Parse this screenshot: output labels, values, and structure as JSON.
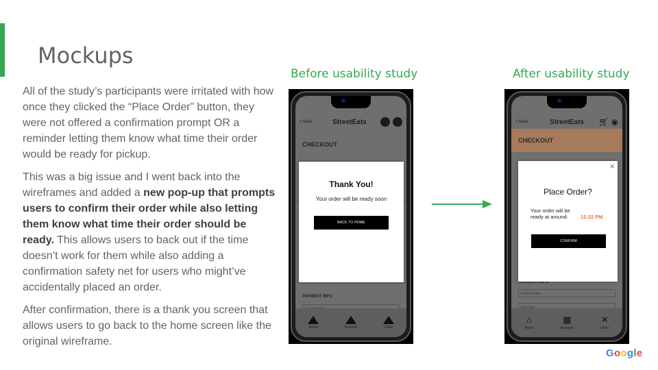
{
  "slide": {
    "title": "Mockups",
    "paragraphs": {
      "p1": "All of the study’s participants were irritated with how once they clicked the “Place Order” button, they were not offered a confirmation prompt OR a reminder letting them know what time their order would be ready for pickup.",
      "p2_before": "This was a big issue and I went back into the wireframes and added a ",
      "p2_bold": "new pop-up that prompts users to confirm their order while also letting them know what time their order should be ready.",
      "p2_after": " This allows users to back out if the time doesn’t work for them while also adding a confirmation safety net for users who might’ve accidentally placed an order.",
      "p3": "After confirmation, there is a thank you screen that allows users to go back to the home screen like the original wireframe."
    },
    "captions": {
      "before": "Before usability study",
      "after": "After usability study"
    },
    "logo_text": "Google",
    "colors": {
      "accent": "#34a853",
      "time": "#e8772e",
      "checkout_band": "#a67a5b"
    }
  },
  "before_mockup": {
    "back_label": "< Back",
    "brand": "StreetEats",
    "section_title": "CHECKOUT",
    "modal": {
      "title": "Thank You!",
      "subtitle": "Your order will be ready soon",
      "button": "BACK TO HOME"
    },
    "payment_label": "PAYMENT INFO",
    "card_field": "Card Number",
    "nav": [
      "Home",
      "Rewards",
      "Order"
    ]
  },
  "after_mockup": {
    "back_label": "< Back",
    "brand": "StreetEats",
    "section_title": "CHECKOUT",
    "modal": {
      "close": "×",
      "title": "Place Order?",
      "ready_line1": "Your order will be",
      "ready_line2": "ready at around:",
      "time": "12:22 PM",
      "button": "CONFIRM"
    },
    "payment_label": "PAYMENT INFO",
    "card_field": "Card Number",
    "exp_field": "Exp Date",
    "nav": [
      "Home",
      "Rewards",
      "Order"
    ]
  }
}
